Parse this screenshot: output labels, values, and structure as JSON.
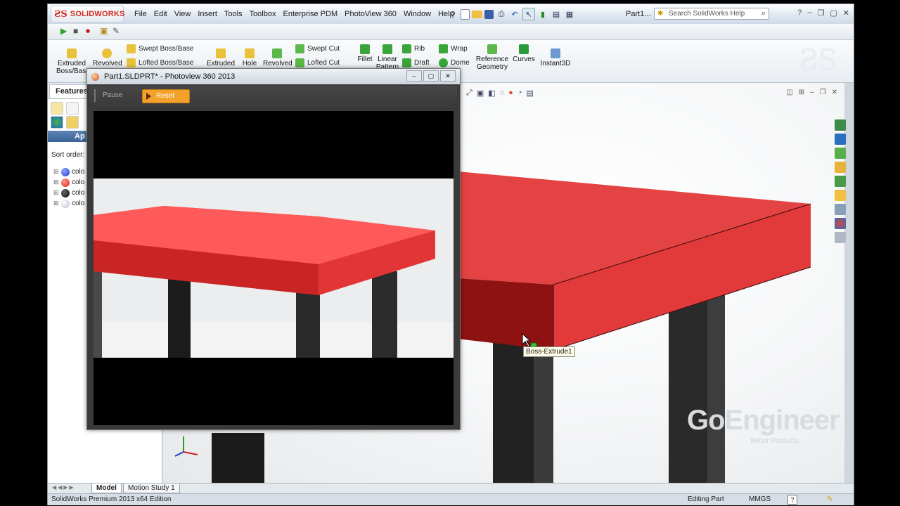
{
  "app": {
    "brand": "SOLIDWORKS",
    "menu": [
      "File",
      "Edit",
      "View",
      "Insert",
      "Tools",
      "Toolbox",
      "Enterprise PDM",
      "PhotoView 360",
      "Window",
      "Help"
    ],
    "doc_title": "Part1...",
    "help_search_placeholder": "Search SolidWorks Help"
  },
  "ribbon": {
    "extruded_boss": "Extruded Boss/Base",
    "revolved_boss": "Revolved",
    "swept_boss": "Swept Boss/Base",
    "lofted_boss": "Lofted Boss/Base",
    "extruded_cut": "Extruded",
    "hole": "Hole",
    "revolved_cut": "Revolved",
    "swept_cut": "Swept Cut",
    "lofted_cut": "Lofted Cut",
    "fillet": "Fillet",
    "linear_pattern": "Linear Pattern",
    "rib": "Rib",
    "draft": "Draft",
    "wrap": "Wrap",
    "dome": "Dome",
    "reference_geometry": "Reference Geometry",
    "curves": "Curves",
    "instant3d": "Instant3D"
  },
  "left_panel": {
    "tab_features": "Features",
    "appearances_header": "Ap",
    "sort_order_label": "Sort order:",
    "items": [
      {
        "label": "colo",
        "color": "#1f3fd0"
      },
      {
        "label": "colo",
        "color": "#e0201c"
      },
      {
        "label": "colo",
        "color": "#0a0a0a"
      },
      {
        "label": "colo",
        "color": "#cfd3e6"
      }
    ]
  },
  "photoview": {
    "title": "Part1.SLDPRT* - Photoview 360 2013",
    "pause_label": "Pause",
    "reset_label": "Reset"
  },
  "graphics": {
    "tooltip": "Boss-Extrude1",
    "watermark": "GoEngineer",
    "watermark_tagline": "Better Products."
  },
  "bottom_tabs": {
    "model": "Model",
    "motion_study": "Motion Study 1"
  },
  "status": {
    "edition": "SolidWorks Premium 2013 x64 Edition",
    "mode": "Editing Part",
    "units": "MMGS",
    "help_icon": "?"
  },
  "colors": {
    "tabletop": "#e23a3a",
    "accent_orange": "#f2a12a",
    "brand_red": "#d52b1e"
  }
}
